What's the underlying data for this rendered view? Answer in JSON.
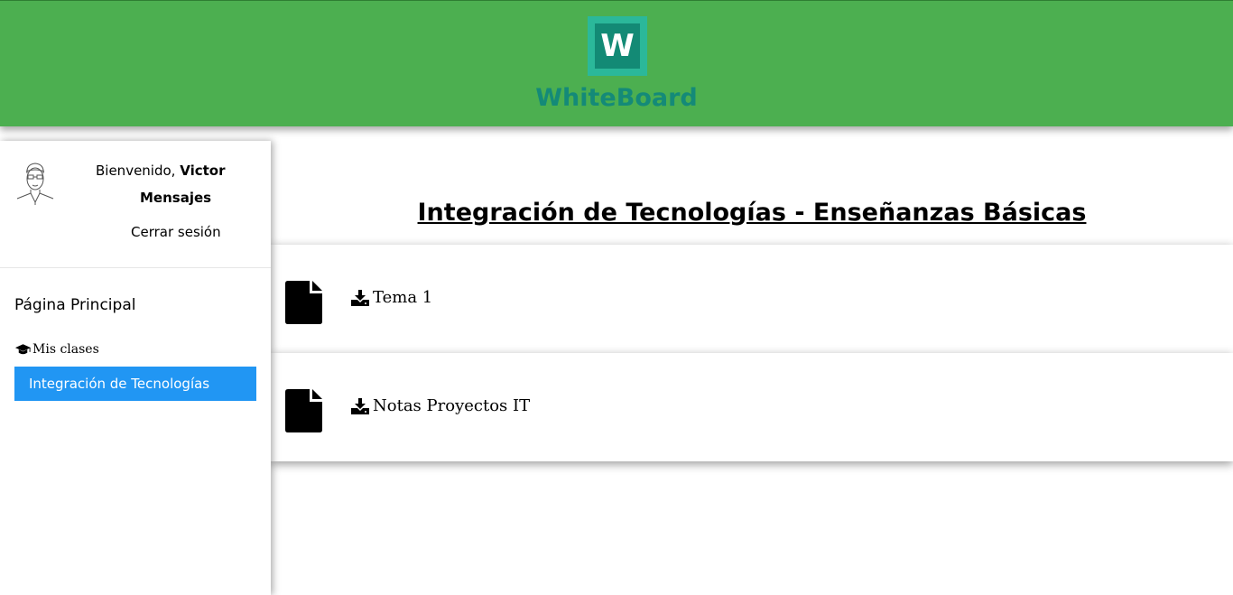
{
  "header": {
    "logo_letter": "W",
    "brand_name": "WhiteBoard",
    "colors": {
      "background": "#4caf50",
      "logo_outer": "#2bb89a",
      "logo_inner": "#138a75",
      "brand_text": "#148a78"
    }
  },
  "sidebar": {
    "user": {
      "greeting": "Bienvenido,",
      "name": "Victor",
      "messages_label": "Mensajes",
      "logout_label": "Cerrar sesión",
      "avatar_icon": "user-sketch-avatar"
    },
    "home_label": "Página Principal",
    "classes_label": "Mis clases",
    "classes_icon": "graduation-cap-icon",
    "classes": [
      {
        "label": "Integración de Tecnologías",
        "active": true
      }
    ],
    "active_color": "#2196f3"
  },
  "main": {
    "title": "Integración de Tecnologías - Enseñanzas Básicas",
    "files": [
      {
        "name": "Tema 1",
        "icon": "file-icon",
        "action_icon": "download-icon"
      },
      {
        "name": "Notas Proyectos IT",
        "icon": "file-icon",
        "action_icon": "download-icon"
      }
    ]
  }
}
